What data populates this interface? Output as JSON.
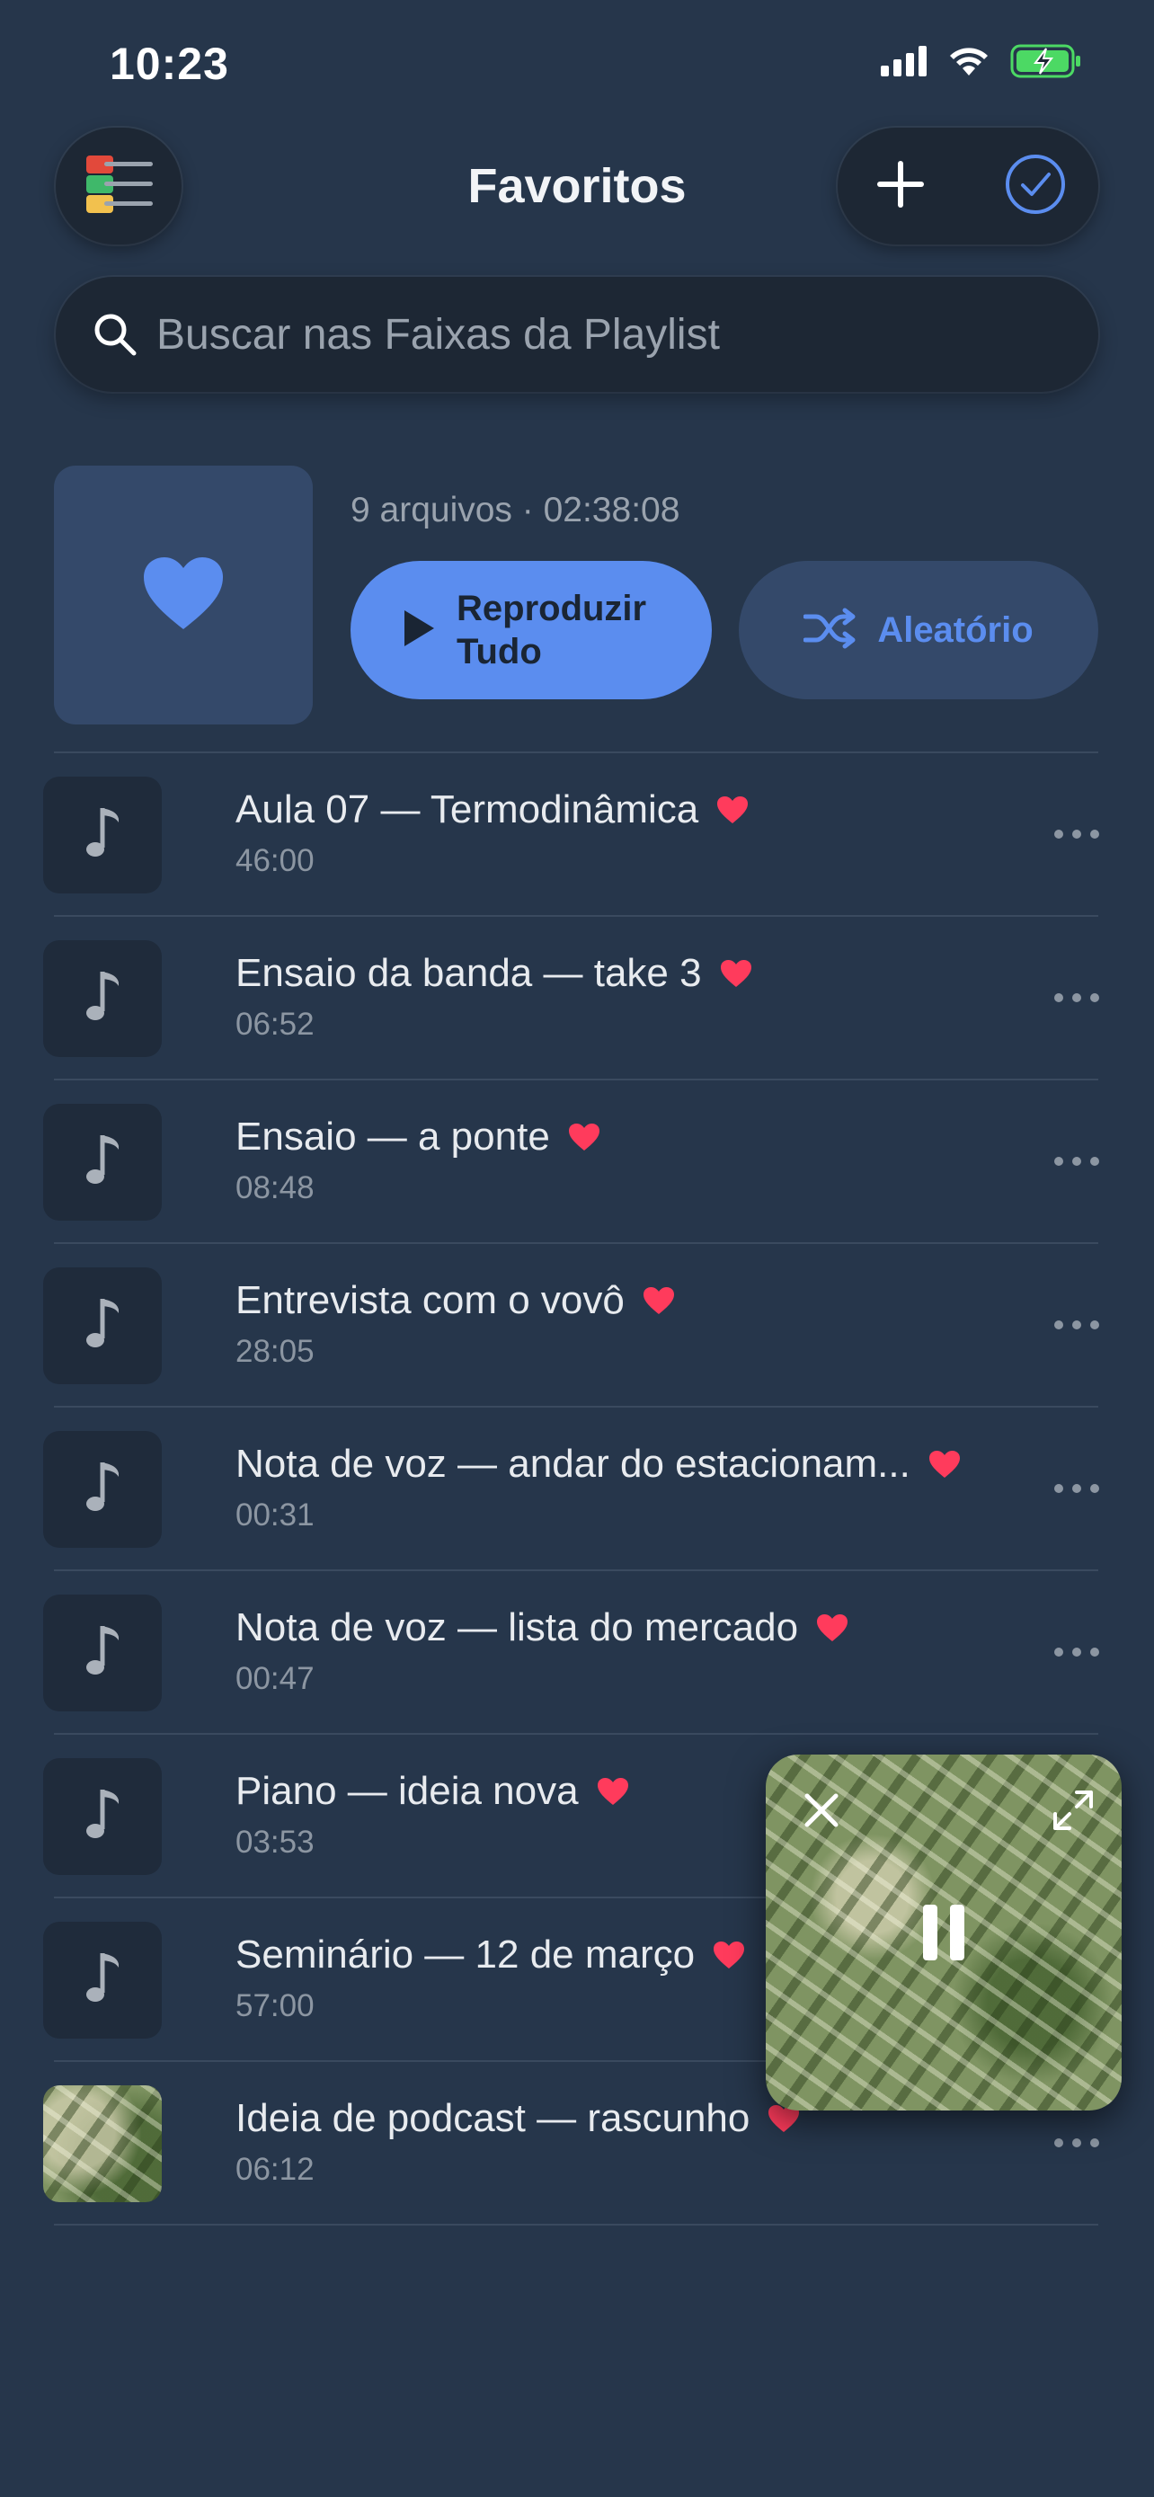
{
  "status_bar": {
    "time": "10:23"
  },
  "header": {
    "title": "Favoritos"
  },
  "search": {
    "placeholder": "Buscar nas Faixas da Playlist",
    "value": ""
  },
  "playlist": {
    "meta": "9 arquivos · 02:38:08",
    "play_all_label": "Reproduzir Tudo",
    "shuffle_label": "Aleatório"
  },
  "colors": {
    "background": "#26364b",
    "accent": "#5b8def",
    "heart": "#ff3b5c"
  },
  "tracks": [
    {
      "title": "Aula 07 — Termodinâmica",
      "duration": "46:00",
      "favorite": true,
      "artwork": "music-note-icon"
    },
    {
      "title": "Ensaio da banda — take 3",
      "duration": "06:52",
      "favorite": true,
      "artwork": "music-note-icon"
    },
    {
      "title": "Ensaio — a ponte",
      "duration": "08:48",
      "favorite": true,
      "artwork": "music-note-icon"
    },
    {
      "title": "Entrevista com o vovô",
      "duration": "28:05",
      "favorite": true,
      "artwork": "music-note-icon"
    },
    {
      "title": "Nota de voz — andar do estacionam...",
      "duration": "00:31",
      "favorite": true,
      "artwork": "music-note-icon"
    },
    {
      "title": "Nota de voz — lista do mercado",
      "duration": "00:47",
      "favorite": true,
      "artwork": "music-note-icon"
    },
    {
      "title": "Piano — ideia nova",
      "duration": "03:53",
      "favorite": true,
      "artwork": "music-note-icon"
    },
    {
      "title": "Seminário — 12 de março",
      "duration": "57:00",
      "favorite": true,
      "artwork": "music-note-icon"
    },
    {
      "title": "Ideia de podcast — rascunho",
      "duration": "06:12",
      "favorite": true,
      "artwork": "leaf-photo"
    }
  ],
  "mini_player": {
    "state": "playing"
  }
}
